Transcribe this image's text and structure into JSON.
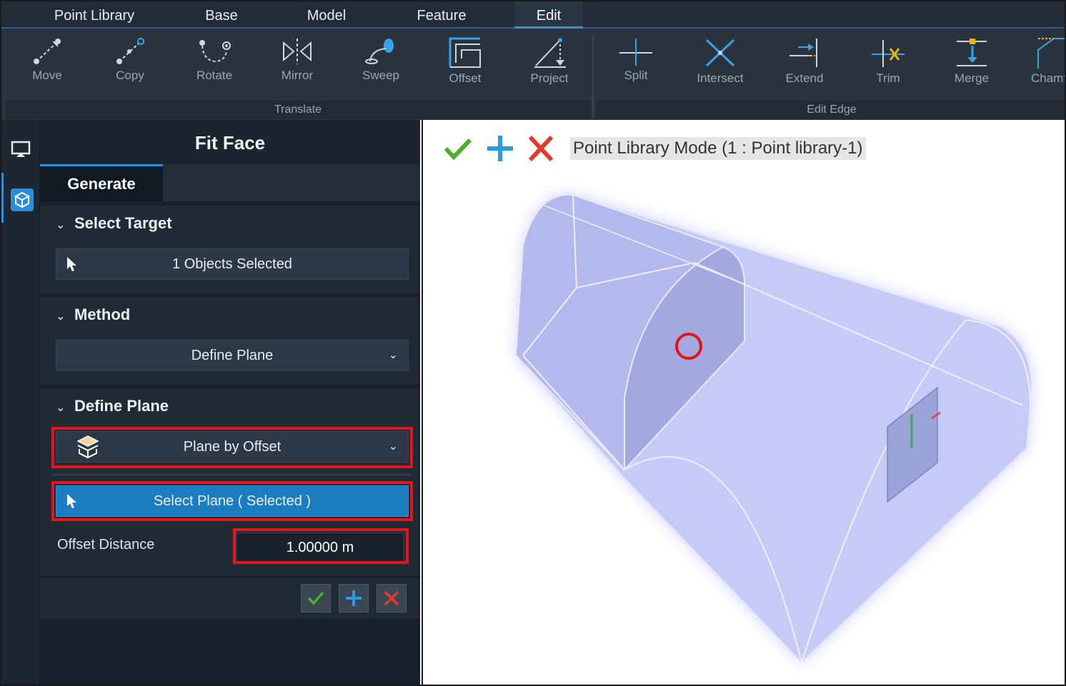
{
  "menu": {
    "tabs": [
      {
        "label": "Point Library"
      },
      {
        "label": "Base"
      },
      {
        "label": "Model"
      },
      {
        "label": "Feature"
      },
      {
        "label": "Edit",
        "active": true
      }
    ]
  },
  "ribbon": {
    "translate_group": "Translate",
    "edit_edge_group": "Edit Edge",
    "tools": [
      {
        "label": "Move",
        "icon": "move-icon"
      },
      {
        "label": "Copy",
        "icon": "copy-icon"
      },
      {
        "label": "Rotate",
        "icon": "rotate-icon"
      },
      {
        "label": "Mirror",
        "icon": "mirror-icon"
      },
      {
        "label": "Sweep",
        "icon": "sweep-icon"
      },
      {
        "label": "Offset",
        "icon": "offset-icon"
      },
      {
        "label": "Project",
        "icon": "project-icon"
      },
      {
        "label": "Split",
        "icon": "split-icon"
      },
      {
        "label": "Intersect",
        "icon": "intersect-icon"
      },
      {
        "label": "Extend",
        "icon": "extend-icon"
      },
      {
        "label": "Trim",
        "icon": "trim-icon"
      },
      {
        "label": "Merge",
        "icon": "merge-icon"
      },
      {
        "label": "Chamf",
        "icon": "chamfer-icon"
      }
    ]
  },
  "panel": {
    "title": "Fit Face",
    "tab_generate": "Generate",
    "select_target": {
      "heading": "Select Target",
      "value": "1 Objects Selected"
    },
    "method": {
      "heading": "Method",
      "value": "Define Plane"
    },
    "define_plane": {
      "heading": "Define Plane",
      "plane_type": "Plane by Offset",
      "select_plane": "Select Plane ( Selected )",
      "offset_label": "Offset Distance",
      "offset_value": "1.00000 m"
    }
  },
  "viewport": {
    "mode_label": "Point Library Mode (1 : Point library-1)"
  },
  "colors": {
    "accent_blue": "#2a8fd6",
    "highlight_red": "#e3141b",
    "ok_green": "#4caf2a",
    "cancel_red": "#e53a2a"
  }
}
